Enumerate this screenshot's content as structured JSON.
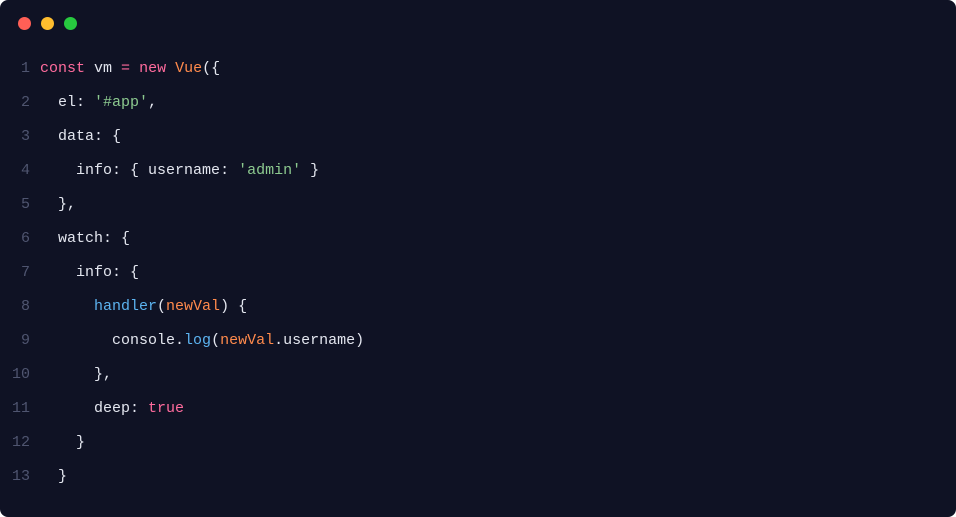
{
  "titlebar": {
    "dots": [
      "red",
      "yellow",
      "green"
    ]
  },
  "code": {
    "lines": [
      {
        "num": "1",
        "indent": "",
        "tokens": [
          {
            "t": "const ",
            "c": "kw"
          },
          {
            "t": "vm",
            "c": "var"
          },
          {
            "t": " ",
            "c": "punc"
          },
          {
            "t": "=",
            "c": "kw"
          },
          {
            "t": " ",
            "c": "punc"
          },
          {
            "t": "new ",
            "c": "kw"
          },
          {
            "t": "Vue",
            "c": "cls"
          },
          {
            "t": "({",
            "c": "punc"
          }
        ]
      },
      {
        "num": "2",
        "indent": "  ",
        "tokens": [
          {
            "t": "el",
            "c": "prop"
          },
          {
            "t": ": ",
            "c": "punc"
          },
          {
            "t": "'#app'",
            "c": "str"
          },
          {
            "t": ",",
            "c": "punc"
          }
        ]
      },
      {
        "num": "3",
        "indent": "  ",
        "tokens": [
          {
            "t": "data",
            "c": "prop"
          },
          {
            "t": ": {",
            "c": "punc"
          }
        ]
      },
      {
        "num": "4",
        "indent": "    ",
        "tokens": [
          {
            "t": "info",
            "c": "prop"
          },
          {
            "t": ": { ",
            "c": "punc"
          },
          {
            "t": "username",
            "c": "prop"
          },
          {
            "t": ": ",
            "c": "punc"
          },
          {
            "t": "'admin'",
            "c": "str"
          },
          {
            "t": " }",
            "c": "punc"
          }
        ]
      },
      {
        "num": "5",
        "indent": "  ",
        "tokens": [
          {
            "t": "},",
            "c": "punc"
          }
        ]
      },
      {
        "num": "6",
        "indent": "  ",
        "tokens": [
          {
            "t": "watch",
            "c": "prop"
          },
          {
            "t": ": {",
            "c": "punc"
          }
        ]
      },
      {
        "num": "7",
        "indent": "    ",
        "tokens": [
          {
            "t": "info",
            "c": "prop"
          },
          {
            "t": ": {",
            "c": "punc"
          }
        ]
      },
      {
        "num": "8",
        "indent": "      ",
        "tokens": [
          {
            "t": "handler",
            "c": "fn"
          },
          {
            "t": "(",
            "c": "punc"
          },
          {
            "t": "newVal",
            "c": "param"
          },
          {
            "t": ") {",
            "c": "punc"
          }
        ]
      },
      {
        "num": "9",
        "indent": "        ",
        "tokens": [
          {
            "t": "console",
            "c": "id"
          },
          {
            "t": ".",
            "c": "dot2"
          },
          {
            "t": "log",
            "c": "fn"
          },
          {
            "t": "(",
            "c": "punc"
          },
          {
            "t": "newVal",
            "c": "param"
          },
          {
            "t": ".",
            "c": "dot2"
          },
          {
            "t": "username",
            "c": "prop"
          },
          {
            "t": ")",
            "c": "punc"
          }
        ]
      },
      {
        "num": "10",
        "indent": "      ",
        "tokens": [
          {
            "t": "},",
            "c": "punc"
          }
        ]
      },
      {
        "num": "11",
        "indent": "      ",
        "tokens": [
          {
            "t": "deep",
            "c": "prop"
          },
          {
            "t": ": ",
            "c": "punc"
          },
          {
            "t": "true",
            "c": "kw"
          }
        ]
      },
      {
        "num": "12",
        "indent": "    ",
        "tokens": [
          {
            "t": "}",
            "c": "punc"
          }
        ]
      },
      {
        "num": "13",
        "indent": "  ",
        "tokens": [
          {
            "t": "}",
            "c": "punc"
          }
        ]
      }
    ]
  }
}
